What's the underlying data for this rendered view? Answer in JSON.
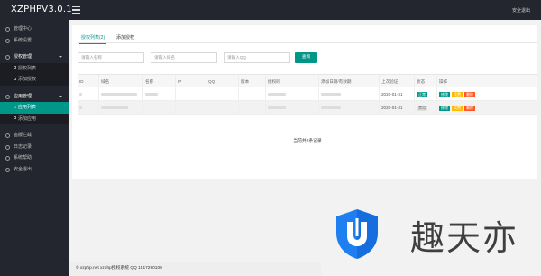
{
  "app": {
    "brand": "XZPHPV3.0.1",
    "logout": "安全退出"
  },
  "sidebar": {
    "items": [
      {
        "label": "管理中心",
        "icon": "home-icon"
      },
      {
        "label": "系统设置",
        "icon": "settings-icon"
      }
    ],
    "group_license": {
      "label": "授权管理",
      "children": [
        "授权列表",
        "添加授权"
      ]
    },
    "group_app": {
      "label": "应用管理",
      "children": [
        "应用列表",
        "添加应用"
      ]
    },
    "bottom": [
      {
        "label": "盗版拦截",
        "icon": "shield-icon"
      },
      {
        "label": "日志记录",
        "icon": "log-icon"
      },
      {
        "label": "系统帮助",
        "icon": "help-icon"
      },
      {
        "label": "安全退出",
        "icon": "exit-icon"
      }
    ]
  },
  "tabs": [
    {
      "label": "授权列表(2)"
    },
    {
      "label": "添加授权"
    }
  ],
  "search": {
    "name_placeholder": "请输入名称",
    "domain_placeholder": "请输入域名",
    "qq_placeholder": "请输入QQ",
    "button": "查询"
  },
  "table": {
    "headers": [
      "ID",
      "域名",
      "名称",
      "IP",
      "QQ",
      "版本",
      "授权码",
      "添加日期/有效期",
      "上次验证",
      "状态",
      "操作"
    ],
    "rows": [
      {
        "date": "2020-01-31",
        "status": "正常",
        "status_type": "green"
      },
      {
        "date": "2020-01-31",
        "status": "禁用",
        "status_type": "gray"
      }
    ],
    "ops": [
      "修改",
      "续费",
      "删除"
    ],
    "summary": "当前共2条记录"
  },
  "footer": "© xzphp.net xzphp授权系统 QQ 1517290109",
  "watermark": {
    "text": "趣天亦"
  },
  "colors": {
    "accent": "#009688",
    "sidebar": "#23262e",
    "yellow": "#ffb800",
    "red": "#ff5722"
  }
}
